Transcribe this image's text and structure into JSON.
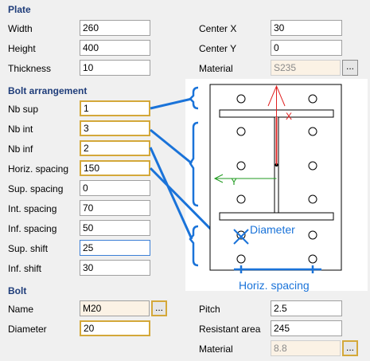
{
  "plate": {
    "title": "Plate",
    "width_label": "Width",
    "width_value": "260",
    "height_label": "Height",
    "height_value": "400",
    "thickness_label": "Thickness",
    "thickness_value": "10",
    "center_x_label": "Center X",
    "center_x_value": "30",
    "center_y_label": "Center Y",
    "center_y_value": "0",
    "material_label": "Material",
    "material_value": "S235"
  },
  "bolt_arrangement": {
    "title": "Bolt arrangement",
    "nb_sup_label": "Nb sup",
    "nb_sup_value": "1",
    "nb_int_label": "Nb int",
    "nb_int_value": "3",
    "nb_inf_label": "Nb inf",
    "nb_inf_value": "2",
    "horiz_spacing_label": "Horiz. spacing",
    "horiz_spacing_value": "150",
    "sup_spacing_label": "Sup. spacing",
    "sup_spacing_value": "0",
    "int_spacing_label": "Int. spacing",
    "int_spacing_value": "70",
    "inf_spacing_label": "Inf. spacing",
    "inf_spacing_value": "50",
    "sup_shift_label": "Sup. shift",
    "sup_shift_value": "25",
    "inf_shift_label": "Inf. shift",
    "inf_shift_value": "30"
  },
  "bolt": {
    "title": "Bolt",
    "name_label": "Name",
    "name_value": "M20",
    "diameter_label": "Diameter",
    "diameter_value": "20",
    "pitch_label": "Pitch",
    "pitch_value": "2.5",
    "resistant_area_label": "Resistant area",
    "resistant_area_value": "245",
    "material_label": "Material",
    "material_value": "8.8"
  },
  "diagram": {
    "x_axis": "X",
    "y_axis": "Y",
    "diameter_label": "Diameter",
    "horiz_spacing_label": "Horiz. spacing"
  },
  "browse_label": "..."
}
